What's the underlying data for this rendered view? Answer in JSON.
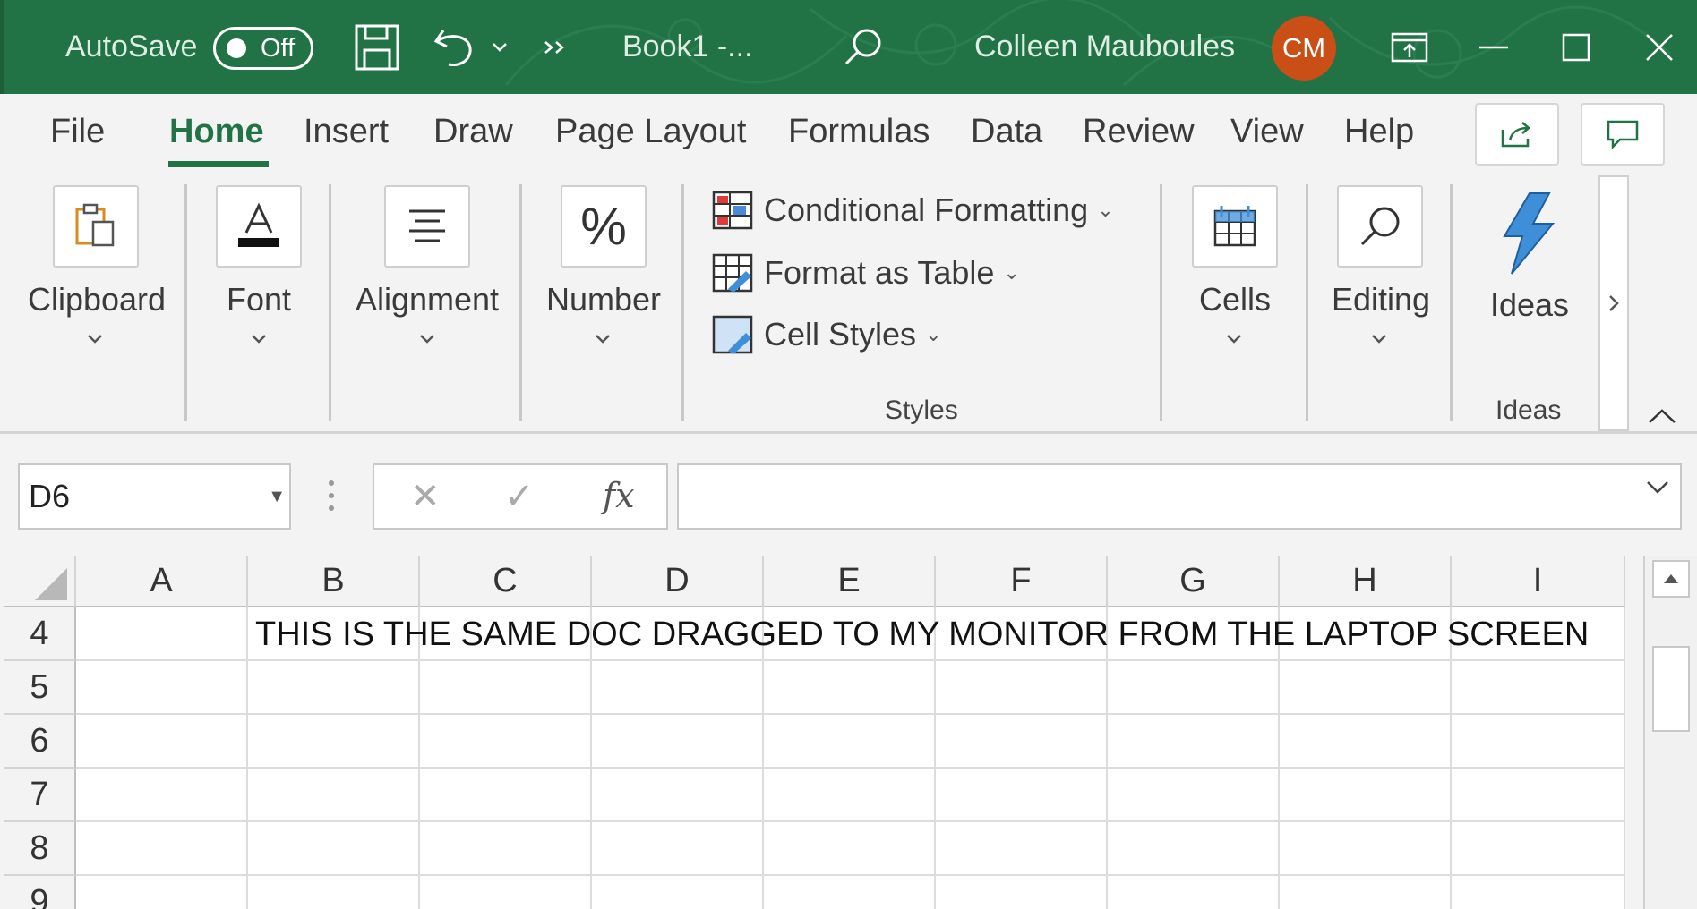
{
  "titlebar": {
    "autosave_label": "AutoSave",
    "autosave_state": "Off",
    "doc_title": "Book1 -...",
    "user_name": "Colleen Mauboules",
    "user_initials": "CM"
  },
  "tabs": [
    "File",
    "Home",
    "Insert",
    "Draw",
    "Page Layout",
    "Formulas",
    "Data",
    "Review",
    "View",
    "Help"
  ],
  "active_tab": "Home",
  "ribbon": {
    "clipboard": "Clipboard",
    "font": "Font",
    "alignment": "Alignment",
    "number": "Number",
    "conditional_formatting": "Conditional Formatting",
    "format_as_table": "Format as Table",
    "cell_styles": "Cell Styles",
    "styles_group": "Styles",
    "cells": "Cells",
    "editing": "Editing",
    "ideas": "Ideas",
    "ideas_group": "Ideas"
  },
  "formula_bar": {
    "name_box": "D6",
    "fx": "fx",
    "value": ""
  },
  "grid": {
    "columns": [
      "A",
      "B",
      "C",
      "D",
      "E",
      "F",
      "G",
      "H",
      "I"
    ],
    "rows": [
      "4",
      "5",
      "6",
      "7",
      "8",
      "9"
    ],
    "cell_B4": "THIS IS THE SAME DOC DRAGGED TO MY MONITOR FROM THE LAPTOP SCREEN"
  },
  "colors": {
    "titlebar_bg": "#217346",
    "avatar_bg": "#c94f17",
    "accent": "#217346"
  }
}
